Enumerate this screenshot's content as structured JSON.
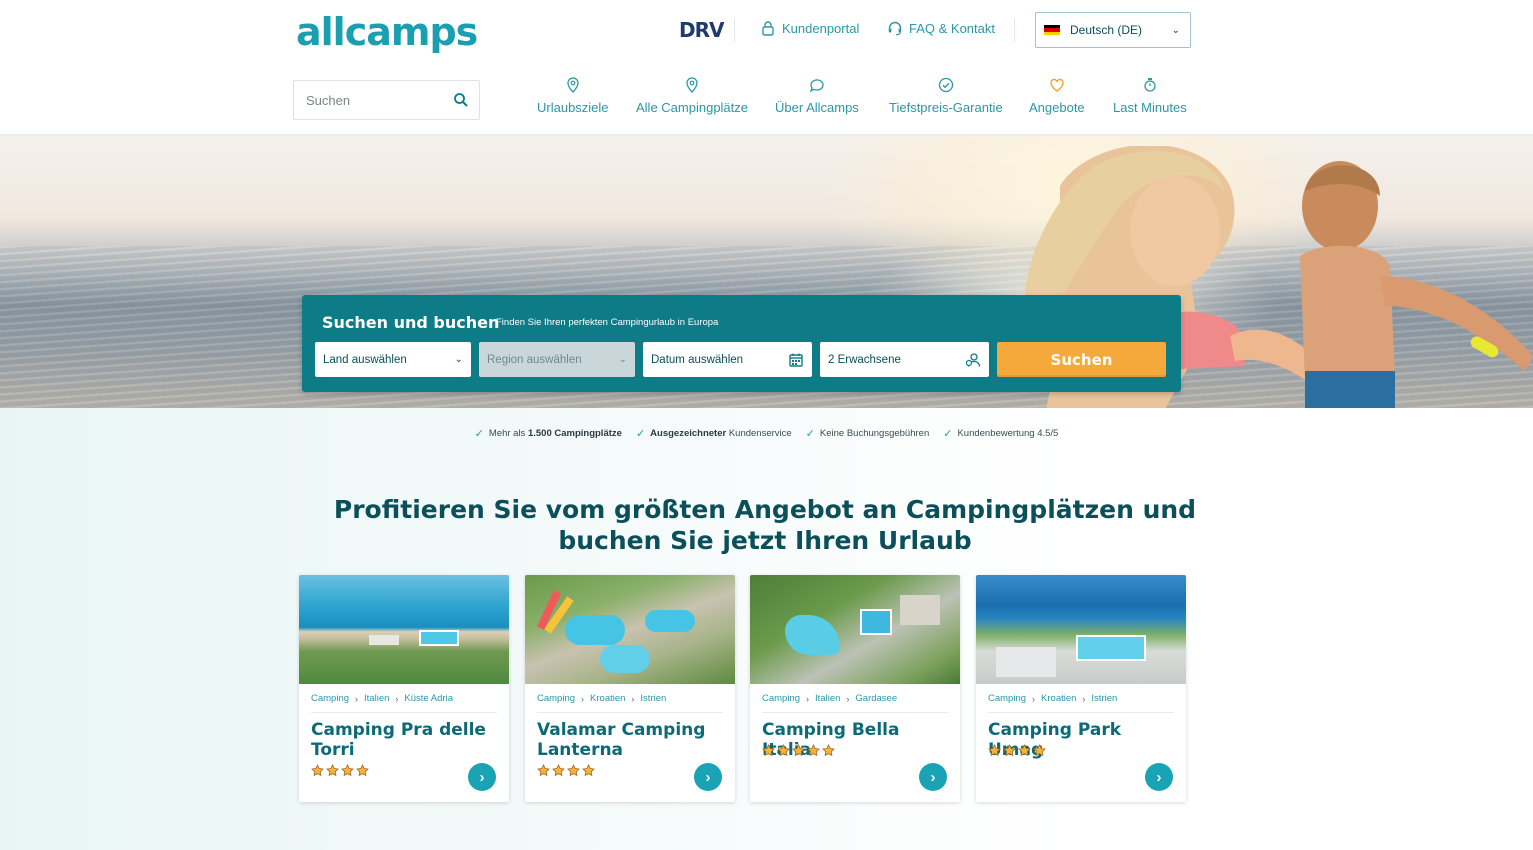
{
  "header": {
    "logo": "allcamps",
    "partner_logo": "DRV",
    "top_links": [
      {
        "label": "Kundenportal",
        "icon": "lock-icon"
      },
      {
        "label": "FAQ & Kontakt",
        "icon": "headset-icon"
      }
    ],
    "language": {
      "label": "Deutsch (DE)",
      "flag": "germany-flag-icon"
    },
    "search": {
      "placeholder": "Suchen"
    },
    "nav": [
      {
        "label": "Urlaubsziele",
        "icon": "map-pin-icon"
      },
      {
        "label": "Alle Campingplätze",
        "icon": "map-pin-icon"
      },
      {
        "label": "Über Allcamps",
        "icon": "chat-bubble-icon"
      },
      {
        "label": "Tiefstpreis-Garantie",
        "icon": "check-circle-icon"
      },
      {
        "label": "Angebote",
        "icon": "heart-icon"
      },
      {
        "label": "Last Minutes",
        "icon": "stopwatch-icon"
      }
    ]
  },
  "booking": {
    "title": "Suchen und buchen",
    "subtitle": "Finden Sie Ihren perfekten Campingurlaub in Europa",
    "country": "Land auswählen",
    "region": "Region auswählen",
    "date": "Datum auswählen",
    "guests": "2 Erwachsene",
    "button": "Suchen"
  },
  "usps": [
    {
      "prefix": "Mehr als ",
      "bold": "1.500 Campingplätze",
      "suffix": ""
    },
    {
      "prefix": "",
      "bold": "Ausgezeichneter",
      "suffix": " Kundenservice"
    },
    {
      "prefix": "Keine Buchungsgebühren",
      "bold": "",
      "suffix": ""
    },
    {
      "prefix": "Kundenbewertung 4.5/5",
      "bold": "",
      "suffix": ""
    }
  ],
  "headline": "Profitieren Sie vom größten Angebot an Campingplätzen und buchen Sie jetzt Ihren Urlaub",
  "campsites": [
    {
      "crumbs": [
        "Camping",
        "Italien",
        "Küste Adria"
      ],
      "title": "Camping Pra delle Torri",
      "stars": 4
    },
    {
      "crumbs": [
        "Camping",
        "Kroatien",
        "Istrien"
      ],
      "title": "Valamar Camping Lanterna",
      "stars": 4
    },
    {
      "crumbs": [
        "Camping",
        "Italien",
        "Gardasee"
      ],
      "title": "Camping Bella Italia",
      "stars": 5
    },
    {
      "crumbs": [
        "Camping",
        "Kroatien",
        "Istrien"
      ],
      "title": "Camping Park Umag",
      "stars": 4
    }
  ],
  "colors": {
    "brand_teal": "#0e7c86",
    "accent_orange": "#f6a93b",
    "link_teal": "#2a97a8"
  }
}
